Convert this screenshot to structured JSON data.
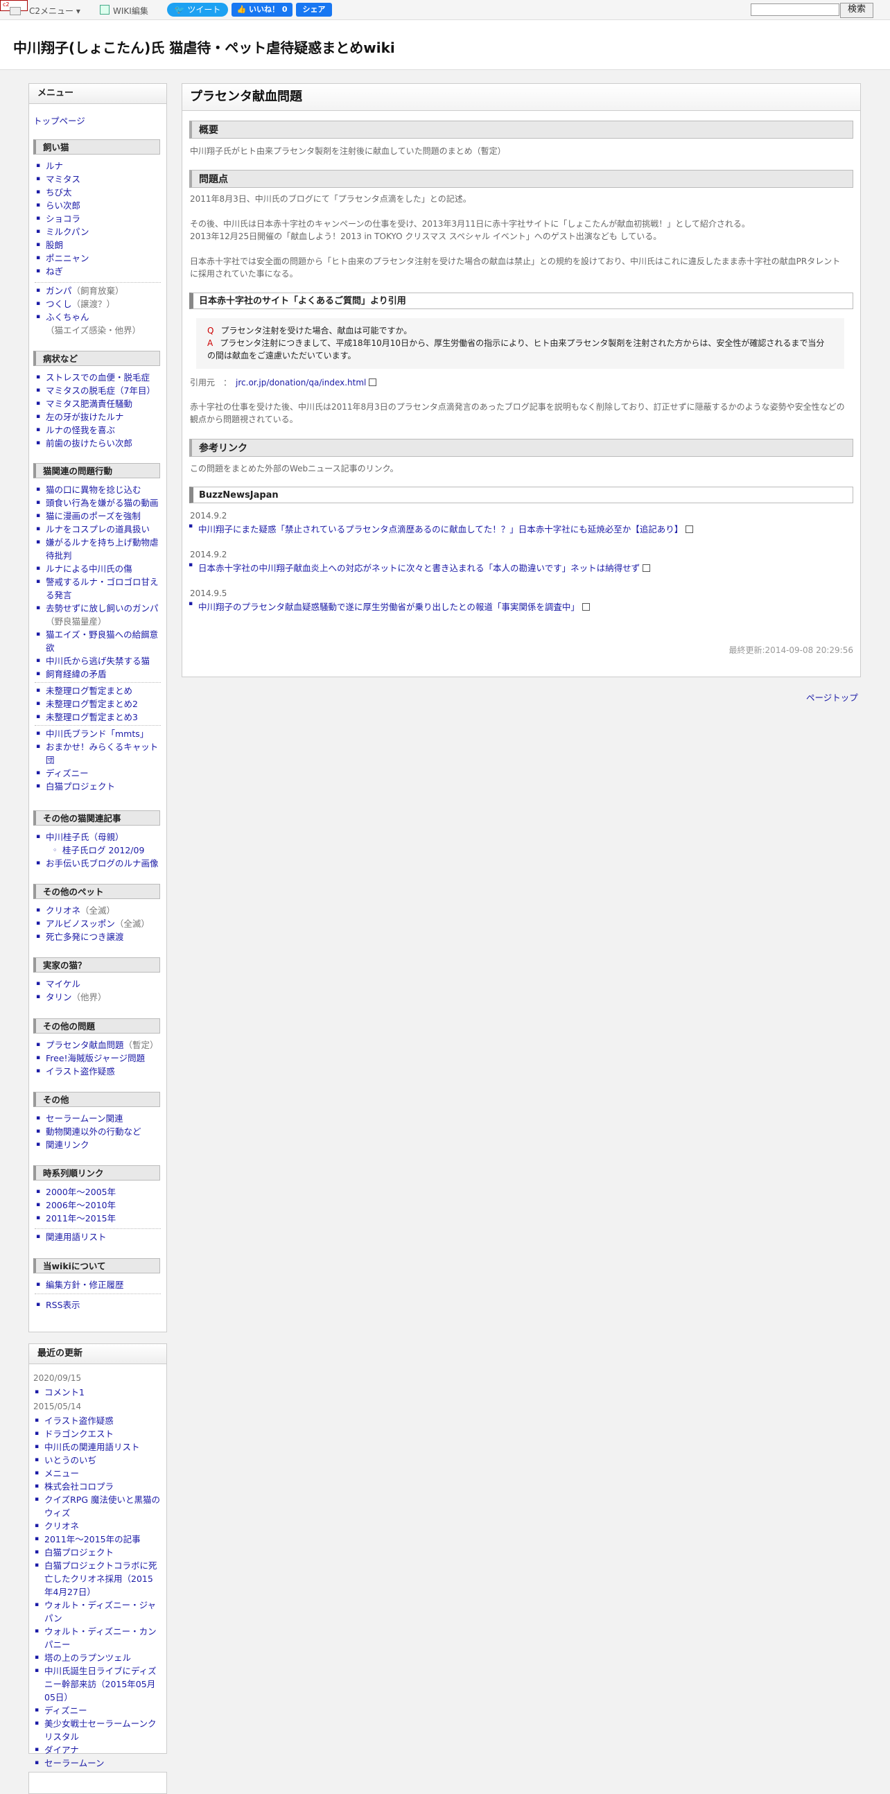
{
  "topbar": {
    "c2menu": "C2メニュー ▾",
    "wiki_edit": "WIKI編集",
    "tweet": "ツイート",
    "like": "いいね！ 0",
    "share": "シェア",
    "search_button": "検索"
  },
  "site_title": "中川翔子(しょこたん)氏 猫虐待・ペット虐待疑惑まとめwiki",
  "sidebar": {
    "title": "メニュー",
    "top_link": "トップページ",
    "sections": {
      "cats": {
        "title": "飼い猫",
        "items": [
          "ルナ",
          "マミタス",
          "ちび太",
          "らい次郎",
          "ショコラ",
          "ミルクパン",
          "股朗",
          "ポニニャン",
          "ねぎ"
        ],
        "items2": [
          {
            "label": "ガンパ",
            "note": "（飼育放棄）"
          },
          {
            "label": "つくし",
            "note": "（譲渡？）"
          },
          {
            "label": "ふくちゃん",
            "note": "（猫エイズ感染・他界）"
          }
        ]
      },
      "illness": {
        "title": "病状など",
        "items": [
          "ストレスでの血便・脱毛症",
          "マミタスの脱毛症（7年目）",
          "マミタス肥満責任騒動",
          "左の牙が抜けたルナ",
          "ルナの怪我を喜ぶ",
          "前歯の抜けたらい次郎"
        ]
      },
      "behavior": {
        "title": "猫関連の問題行動",
        "items": [
          {
            "label": "猫の口に異物を捻じ込む"
          },
          {
            "label": "頭食い行為を嫌がる猫の動画"
          },
          {
            "label": "猫に漫画のポーズを強制"
          },
          {
            "label": "ルナをコスプレの道具扱い"
          },
          {
            "label": "嫌がるルナを持ち上げ動物虐待批判"
          },
          {
            "label": "ルナによる中川氏の傷"
          },
          {
            "label": "警戒するルナ・ゴロゴロ甘える発言"
          },
          {
            "label": "去勢せずに放し飼いのガンパ",
            "note": "（野良猫量産）"
          },
          {
            "label": "猫エイズ・野良猫への給餌意欲"
          },
          {
            "label": "中川氏から逃げ失禁する猫"
          },
          {
            "label": "飼育経緯の矛盾"
          }
        ],
        "items2": [
          "未整理ログ暫定まとめ",
          "未整理ログ暫定まとめ2",
          "未整理ログ暫定まとめ3"
        ],
        "items3": [
          "中川氏ブランド「mmts」",
          "おまかせ！みらくるキャット団",
          "ディズニー",
          "白猫プロジェクト"
        ]
      },
      "other_cat": {
        "title": "その他の猫関連記事",
        "item1": "中川桂子氏（母親）",
        "sub": "桂子氏ログ 2012/09",
        "item2": "お手伝い氏ブログのルナ画像"
      },
      "pets": {
        "title": "その他のペット",
        "items": [
          {
            "label": "クリオネ",
            "note": "（全滅）"
          },
          {
            "label": "アルビノスッポン",
            "note": "（全滅）"
          },
          {
            "label": "死亡多発につき譲渡",
            "note": ""
          }
        ]
      },
      "family_cats": {
        "title": "実家の猫？",
        "items": [
          {
            "label": "マイケル",
            "note": ""
          },
          {
            "label": "タリン",
            "note": "（他界）"
          }
        ]
      },
      "other_issues": {
        "title": "その他の問題",
        "items": [
          {
            "label": "プラセンタ献血問題",
            "note": "（暫定）"
          },
          {
            "label": "Free!海賊版ジャージ問題",
            "note": ""
          },
          {
            "label": "イラスト盗作疑惑",
            "note": ""
          }
        ]
      },
      "others": {
        "title": "その他",
        "items": [
          "セーラームーン関連",
          "動物関連以外の行動など",
          "関連リンク"
        ]
      },
      "timeline": {
        "title": "時系列順リンク",
        "items": [
          "2000年～2005年",
          "2006年～2010年",
          "2011年～2015年"
        ],
        "items2": [
          "関連用語リスト"
        ]
      },
      "about": {
        "title": "当wikiについて",
        "items": [
          "編集方針・修正履歴"
        ],
        "items2": [
          "RSS表示"
        ]
      }
    }
  },
  "recent": {
    "title": "最近の更新",
    "date1": "2020/09/15",
    "items1": [
      "コメント1"
    ],
    "date2": "2015/05/14",
    "items2": [
      "イラスト盗作疑惑",
      "ドラゴンクエスト",
      "中川氏の関連用語リスト",
      "いとうのいぢ",
      "メニュー",
      "株式会社コロプラ",
      "クイズRPG 魔法使いと黒猫のウィズ",
      "クリオネ",
      "2011年～2015年の記事",
      "白猫プロジェクト",
      "白猫プロジェクトコラボに死亡したクリオネ採用（2015年4月27日）",
      "ウォルト・ディズニー・ジャパン",
      "ウォルト・ディズニー・カンパニー",
      "塔の上のラプンツェル",
      "中川氏誕生日ライブにディズニー幹部来訪（2015年05月05日）",
      "ディズニー",
      "美少女戦士セーラームーンクリスタル",
      "ダイアナ",
      "セーラームーン"
    ]
  },
  "main": {
    "title": "プラセンタ献血問題",
    "overview_heading": "概要",
    "overview_text": "中川翔子氏がヒト由来プラセンタ製剤を注射後に献血していた問題のまとめ（暫定）",
    "problem_heading": "問題点",
    "p1": "2011年8月3日、中川氏のブログにて「プラセンタ点滴をした」との記述。",
    "p2": "その後、中川氏は日本赤十字社のキャンペーンの仕事を受け、2013年3月11日に赤十字社サイトに「しょこたんが献血初挑戦！」として紹介される。",
    "p3": "2013年12月25日開催の「献血しよう！2013 in TOKYO クリスマス スペシャル イベント」へのゲスト出演なども している。",
    "p4": "日本赤十字社では安全面の問題から「ヒト由来のプラセンタ注射を受けた場合の献血は禁止」との規約を設けており、中川氏はこれに違反したまま赤十字社の献血PRタレントに採用されていた事になる。",
    "quote_heading": "日本赤十字社のサイト「よくあるご質問」より引用",
    "q_mark": "Q",
    "q_text": "プラセンタ注射を受けた場合、献血は可能ですか。",
    "a_mark": "A",
    "a_text": "プラセンタ注射につきまして、平成18年10月10日から、厚生労働省の指示により、ヒト由来プラセンタ製剤を注射された方からは、安全性が確認されるまで当分の間は献血をご遠慮いただいています。",
    "source_label": "引用元　：",
    "source_link": "jrc.or.jp/donation/qa/index.html",
    "p5": "赤十字社の仕事を受けた後、中川氏は2011年8月3日のプラセンタ点滴発言のあったブログ記事を説明もなく削除しており、訂正せずに隠蔽するかのような姿勢や安全性などの観点から問題視されている。",
    "links_heading": "参考リンク",
    "links_text": "この問題をまとめた外部のWebニュース記事のリンク。",
    "buzz_heading": "BuzzNewsJapan",
    "ref1_date": "2014.9.2",
    "ref1": "中川翔子にまた疑惑「禁止されているプラセンタ点滴歴あるのに献血してた！？」日本赤十字社にも延焼必至か【追記あり】",
    "ref2_date": "2014.9.2",
    "ref2": "日本赤十字社の中川翔子献血炎上への対応がネットに次々と書き込まれる「本人の勘違いです」ネットは納得せず",
    "ref3_date": "2014.9.5",
    "ref3": "中川翔子のプラセンタ献血疑惑騒動で遂に厚生労働省が乗り出したとの報道「事実関係を調査中」",
    "last_updated": "最終更新:2014-09-08 20:29:56"
  },
  "page_top": "ページトップ"
}
